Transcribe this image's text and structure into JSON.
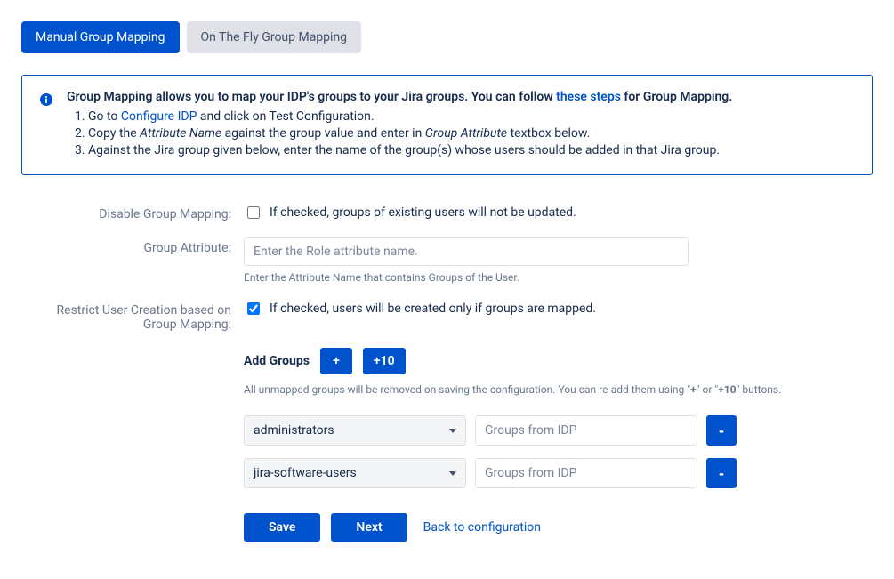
{
  "tabs": {
    "manual": "Manual Group Mapping",
    "otf": "On The Fly Group Mapping"
  },
  "info": {
    "lead_pre": "Group Mapping allows you to map your IDP's groups to your Jira groups. You can follow ",
    "lead_link": "these steps",
    "lead_post": " for Group Mapping.",
    "step1_pre": "Go to ",
    "step1_link": "Configure IDP",
    "step1_post": " and click on Test Configuration.",
    "step2_pre": "Copy the ",
    "step2_em1": "Attribute Name",
    "step2_mid": " against the group value and enter in ",
    "step2_em2": "Group Attribute",
    "step2_post": " textbox below.",
    "step3": "Against the Jira group given below, enter the name of the group(s) whose users should be added in that Jira group."
  },
  "disable": {
    "label": "Disable Group Mapping:",
    "desc": "If checked, groups of existing users will not be updated."
  },
  "attribute": {
    "label": "Group Attribute:",
    "placeholder": "Enter the Role attribute name.",
    "help": "Enter the Attribute Name that contains Groups of the User."
  },
  "restrict": {
    "label": "Restrict User Creation based on Group Mapping:",
    "desc": "If checked, users will be created only if groups are mapped."
  },
  "addGroups": {
    "title": "Add Groups",
    "plus": "+",
    "plus10": "+10",
    "help_pre": "All unmapped groups will be removed on saving the configuration. You can re-add them using \"",
    "help_b1": "+",
    "help_mid": "\" or \"",
    "help_b2": "+10",
    "help_post": "\" buttons."
  },
  "groups": [
    {
      "jira": "administrators",
      "idp_placeholder": "Groups from IDP"
    },
    {
      "jira": "jira-software-users",
      "idp_placeholder": "Groups from IDP"
    }
  ],
  "actions": {
    "save": "Save",
    "next": "Next",
    "back": "Back to configuration"
  }
}
